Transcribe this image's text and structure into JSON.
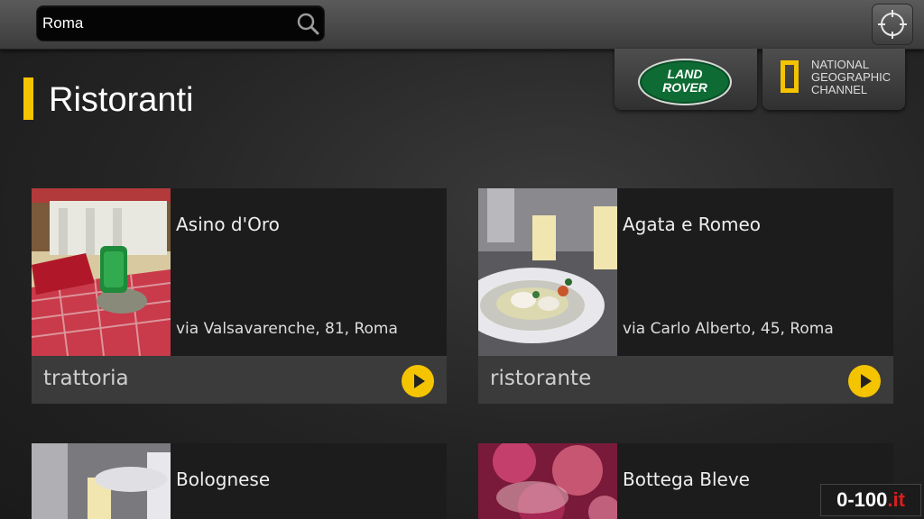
{
  "search": {
    "value": "Roma",
    "placeholder": ""
  },
  "page": {
    "title": "Ristoranti"
  },
  "sponsors": {
    "land_rover": {
      "line1": "LAND",
      "line2": "ROVER",
      "color": "#0d6b33"
    },
    "natgeo": {
      "line1": "NATIONAL",
      "line2": "GEOGRAPHIC",
      "line3": "CHANNEL",
      "color": "#f5c400"
    }
  },
  "restaurants": [
    {
      "name": "Asino d'Oro",
      "address": "via Valsavarenche, 81, Roma",
      "category": "trattoria"
    },
    {
      "name": "Agata e Romeo",
      "address": "via Carlo Alberto, 45, Roma",
      "category": "ristorante"
    },
    {
      "name": "Bolognese",
      "address": "",
      "category": ""
    },
    {
      "name": "Bottega Bleve",
      "address": "",
      "category": ""
    }
  ],
  "watermark": {
    "prefix": "0-100",
    "suffix": ".it"
  },
  "colors": {
    "accent": "#f5c400"
  }
}
